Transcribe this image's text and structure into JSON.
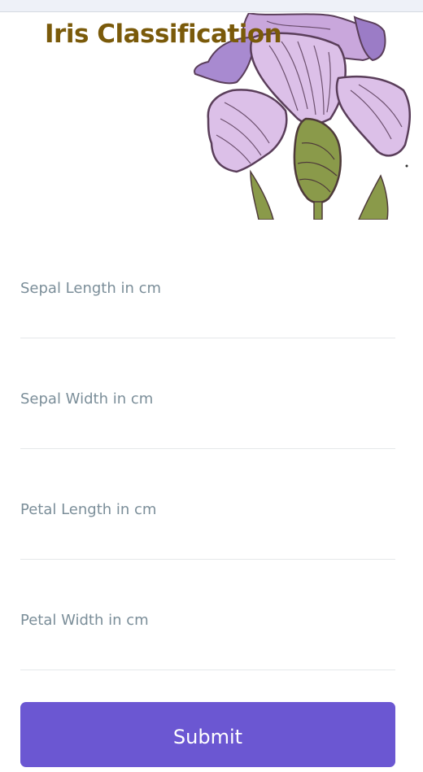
{
  "header": {
    "title": "Iris Classification"
  },
  "form": {
    "fields": [
      {
        "label": "Sepal Length in cm"
      },
      {
        "label": "Sepal Width in cm"
      },
      {
        "label": "Petal Length in cm"
      },
      {
        "label": "Petal Width in cm"
      }
    ],
    "submit_label": "Submit"
  },
  "colors": {
    "title": "#7a5a0a",
    "button": "#6b57d2",
    "label": "#7b8e99",
    "petal_light": "#d8b8e0",
    "petal_dark": "#9b7cc6",
    "stem": "#8a9a4a"
  },
  "icons": {
    "hero": "iris-flower-illustration"
  }
}
